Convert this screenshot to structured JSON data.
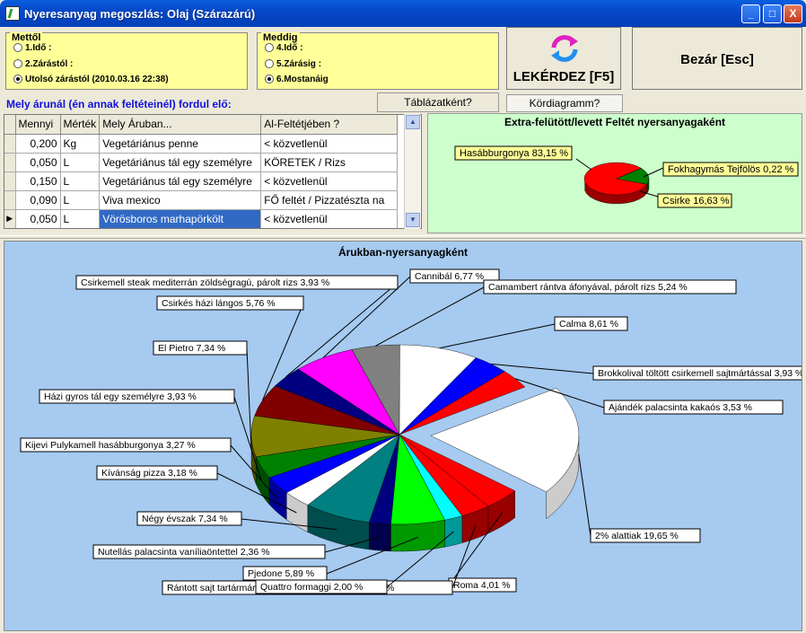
{
  "window": {
    "title": "Nyeresanyag megoszlás: Olaj  (Szárazárú)",
    "buttons": [
      "_",
      "□",
      "X"
    ]
  },
  "from_group": {
    "title": "Mettől",
    "options": [
      {
        "label": "1.Idő :",
        "selected": false
      },
      {
        "label": "2.Zárástól :",
        "selected": false
      },
      {
        "label": "Utolsó zárástól (2010.03.16 22:38)",
        "selected": true
      }
    ]
  },
  "to_group": {
    "title": "Meddig",
    "options": [
      {
        "label": "4.Idő :",
        "selected": false
      },
      {
        "label": "5.Zárásig :",
        "selected": false
      },
      {
        "label": "6.Mostanáig",
        "selected": true
      }
    ]
  },
  "query_button": {
    "label": "LEKÉRDEZ [F5]",
    "icon": "refresh-icon"
  },
  "close_button": {
    "label": "Bezár [Esc]"
  },
  "view_tabs": {
    "table": "Táblázatként?",
    "pie": "Kördiagramm?"
  },
  "list_heading": "Mely árunál (én annak feltéteinél) fordul elő:",
  "grid": {
    "columns": [
      "Mennyi",
      "Mérték",
      "Mely Áruban...",
      "Al-Feltétjében ?"
    ],
    "rows": [
      [
        "0,200",
        "Kg",
        "Vegetáriánus penne",
        " < közvetlenül"
      ],
      [
        "0,050",
        "L",
        "Vegetáriánus tál egy személyre",
        "KÖRETEK / Rizs"
      ],
      [
        "0,150",
        "L",
        "Vegetáriánus tál egy személyre",
        " < közvetlenül"
      ],
      [
        "0,090",
        "L",
        "Viva mexico",
        "FŐ feltét / Pizzatészta na"
      ],
      [
        "0,050",
        "L",
        "Vörösboros marhapörkölt",
        " < közvetlenül"
      ]
    ],
    "selected_row": 4
  },
  "small_chart": {
    "title": "Extra-felütött/levett Feltét nyersanyagaként",
    "labels": [
      "Hasábburgonya 83,15 %",
      "Fokhagymás Tejfölös 0,22 %",
      "Csirke 16,63 %"
    ]
  },
  "big_chart": {
    "title": "Árukban-nyersanyagként"
  },
  "chart_data": [
    {
      "type": "pie",
      "title": "Extra-felütött/levett Feltét nyersanyagaként",
      "series": [
        {
          "name": "Hasábburgonya",
          "value": 83.15,
          "color": "#ff0000"
        },
        {
          "name": "Fokhagymás Tejfölös",
          "value": 0.22,
          "color": "#0000cc"
        },
        {
          "name": "Csirke",
          "value": 16.63,
          "color": "#008000"
        }
      ]
    },
    {
      "type": "pie",
      "title": "Árukban-nyersanyagként",
      "series": [
        {
          "name": "2% alattiak",
          "value": 19.65,
          "color": "#ffffff",
          "label": "2% alattiak 19,65 %"
        },
        {
          "name": "Roma",
          "value": 4.01,
          "color": "#ff0000",
          "label": "Roma 4,01 %"
        },
        {
          "name": "Rántott sajt tartármártással, hasábburgonyával",
          "value": 3.27,
          "color": "#ff0000",
          "label": "Rántott sajt tartármártással, hasábburgonyával 3,27 %"
        },
        {
          "name": "Quattro formaggi",
          "value": 2.0,
          "color": "#00ffff",
          "label": "Quattro formaggi 2,00 %"
        },
        {
          "name": "Pjedone",
          "value": 5.89,
          "color": "#00ff00",
          "label": "Pjedone 5,89 %"
        },
        {
          "name": "Nutellás palacsinta vaníliaöntettel",
          "value": 2.36,
          "color": "#000080",
          "label": "Nutellás palacsinta vaníliaöntettel 2,36 %"
        },
        {
          "name": "Négy évszak",
          "value": 7.34,
          "color": "#008080",
          "label": "Négy évszak 7,34 %"
        },
        {
          "name": "Kívánság pizza",
          "value": 3.18,
          "color": "#ffffff",
          "label": "Kívánság pizza 3,18 %"
        },
        {
          "name": "Kijevi Pulykamell hasábburgonya",
          "value": 3.27,
          "color": "#0000ff",
          "label": "Kijevi Pulykamell hasábburgonya 3,27 %"
        },
        {
          "name": "Házi gyros tál egy személyre",
          "value": 3.93,
          "color": "#008000",
          "label": "Házi gyros tál egy személyre 3,93 %"
        },
        {
          "name": "El Pietro",
          "value": 7.34,
          "color": "#808000",
          "label": "El Pietro 7,34 %"
        },
        {
          "name": "Csirkés házi lángos",
          "value": 5.76,
          "color": "#800000",
          "label": "Csirkés házi lángos 5,76 %"
        },
        {
          "name": "Csirkemell steak mediterrán zöldségragú, párolt rizs",
          "value": 3.93,
          "color": "#000080",
          "label": "Csirkemell steak mediterrán zöldségragú, párolt rizs 3,93 %"
        },
        {
          "name": "Cannibál",
          "value": 6.77,
          "color": "#ff00ff",
          "label": "Cannibál 6,77 %"
        },
        {
          "name": "Camambert rántva áfonyával, párolt rizs",
          "value": 5.24,
          "color": "#808080",
          "label": "Camambert rántva áfonyával, párolt rizs 5,24 %"
        },
        {
          "name": "Calma",
          "value": 8.61,
          "color": "#ffffff",
          "label": "Calma 8,61 %"
        },
        {
          "name": "Brokkolival töltött csirkemell sajtmártással",
          "value": 3.93,
          "color": "#0000ff",
          "label": "Brokkolival töltött csirkemell sajtmártással 3,93 %"
        },
        {
          "name": "Ajándék palacsinta kakaós",
          "value": 3.53,
          "color": "#ff0000",
          "label": "Ajándék palacsinta kakaós 3,53 %"
        }
      ]
    }
  ]
}
